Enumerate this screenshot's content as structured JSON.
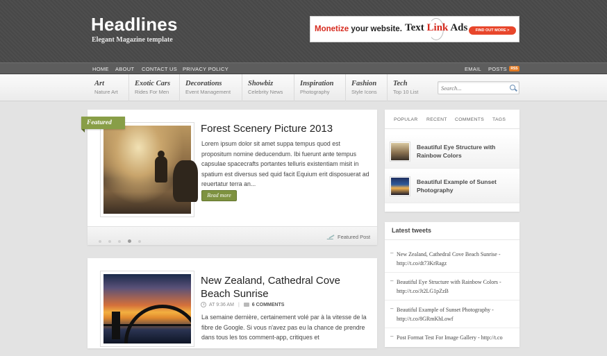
{
  "header": {
    "title": "Headlines",
    "tagline": "Elegant Magazine template",
    "ad": {
      "monetize": "Monetize",
      "your_website": " your website.",
      "brand_text": "Text ",
      "brand_link": "Link",
      "brand_ads": " Ads",
      "cta": "FIND OUT MORE >"
    }
  },
  "topnav": {
    "left": [
      "HOME",
      "ABOUT",
      "CONTACT US",
      "PRIVACY POLICY"
    ],
    "right": [
      "EMAIL",
      "POSTS"
    ],
    "rss_badge": "RSS"
  },
  "categories": [
    {
      "title": "Art",
      "sub": "Nature Art"
    },
    {
      "title": "Exotic Cars",
      "sub": "Rides For Men"
    },
    {
      "title": "Decorations",
      "sub": "Event Management"
    },
    {
      "title": "Showbiz",
      "sub": "Celebrity News"
    },
    {
      "title": "Inspiration",
      "sub": "Photography"
    },
    {
      "title": "Fashion",
      "sub": "Style Icons"
    },
    {
      "title": "Tech",
      "sub": "Top 10 List"
    }
  ],
  "search": {
    "placeholder": "Search..."
  },
  "featured": {
    "ribbon": "Featured",
    "title": "Forest Scenery Picture 2013",
    "excerpt": "Lorem ipsum dolor sit amet suppa tempus quod est propositum nomine deducendum. Ibi fuerunt ante tempus capsulae spacecrafts portantes telluris existentiam misit in spatium est diversus sed quid facit Equium erit disposuerat ad reuertatur terra an...",
    "read_more": "Read more",
    "footer_label": "Featured Post"
  },
  "post2": {
    "title": "New Zealand, Cathedral Cove Beach Sunrise",
    "time": "AT 9:36 AM",
    "comments": "6 COMMENTS",
    "excerpt": "La semaine dernière, certainement volé par à la vitesse de la fibre de Google. Si vous n'avez pas eu la chance de prendre dans tous les tos comment-app, critiques et"
  },
  "sidebar": {
    "tabs": [
      "POPULAR",
      "RECENT",
      "COMMENTS",
      "TAGS"
    ],
    "popular": [
      {
        "title": "Beautiful Eye Structure with Rainbow Colors"
      },
      {
        "title": "Beautiful Example of Sunset Photography"
      }
    ],
    "tweets_title": "Latest tweets",
    "tweets": [
      "New Zealand, Cathedral Cove Beach Sunrise - http://t.co/dt73KrRagz",
      "Beautiful Eye Structure with Rainbow Colors - http://t.co/Jt2LG1pZzB",
      "Beautiful Example of Sunset Photography - http://t.co/8GRmKhLowf",
      "Post Format Test For Image Gallery - http://t.co"
    ]
  },
  "colors": {
    "accent_green": "#7e9240",
    "header_bg": "#4a4a4a",
    "rss_orange": "#e27a23"
  }
}
